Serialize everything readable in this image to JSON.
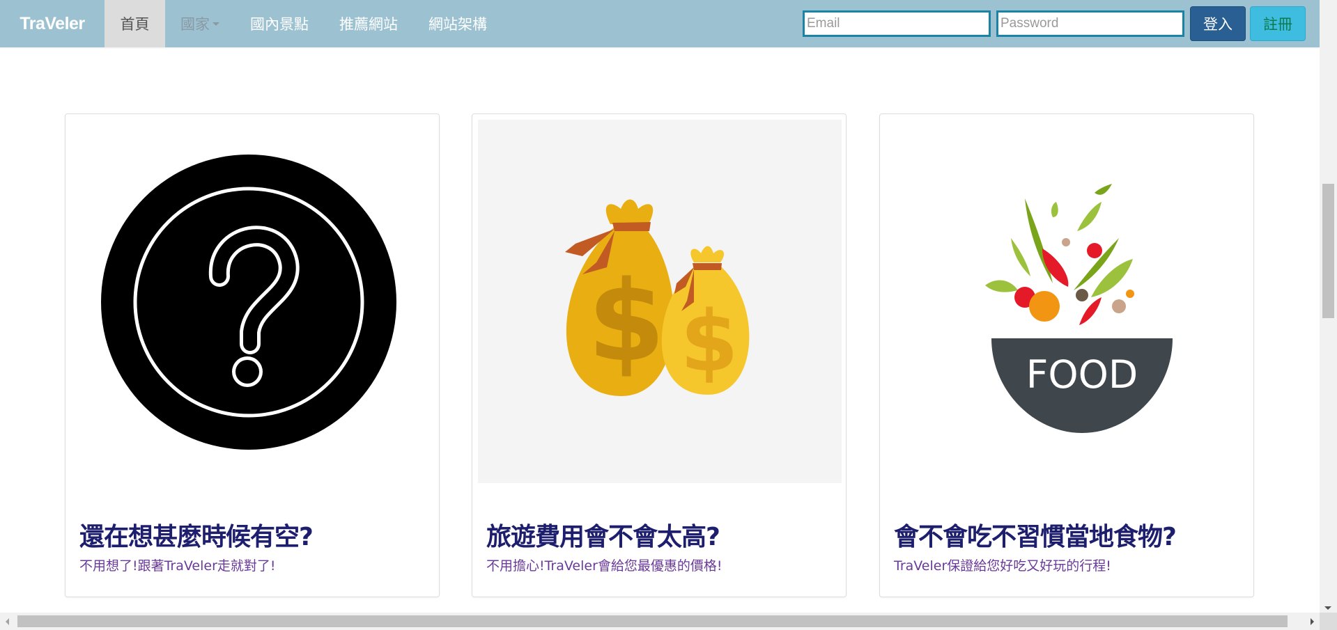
{
  "navbar": {
    "brand": "TraVeler",
    "items": [
      {
        "label": "首頁",
        "active": true
      },
      {
        "label": "國家",
        "dropdown": true
      },
      {
        "label": "國內景點"
      },
      {
        "label": "推薦網站"
      },
      {
        "label": "網站架構"
      }
    ],
    "login": {
      "email_placeholder": "Email",
      "password_placeholder": "Password",
      "login_label": "登入",
      "register_label": "註冊"
    }
  },
  "cards": [
    {
      "title": "還在想甚麼時候有空?",
      "text": "不用想了!跟著TraVeler走就對了!",
      "icon": "question-circle-icon"
    },
    {
      "title": "旅遊費用會不會太高?",
      "text": "不用擔心!TraVeler會給您最優惠的價格!",
      "icon": "money-bags-icon"
    },
    {
      "title": "會不會吃不習慣當地食物?",
      "text": "TraVeler保證給您好吃又好玩的行程!",
      "icon": "food-bowl-icon",
      "icon_text": "FOOD"
    }
  ],
  "colors": {
    "navbar_bg": "#9cc1d1",
    "login_button": "#2a5f94",
    "register_button": "#3fbde0",
    "card_title": "#1e1e6e",
    "card_text": "#6a3a9a"
  }
}
